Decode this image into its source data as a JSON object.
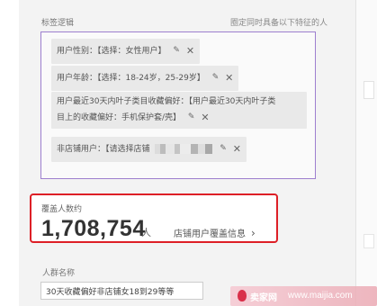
{
  "section": {
    "tag_logic_label": "标签逻辑",
    "hint": "圈定同时具备以下特征的人"
  },
  "tags": [
    {
      "text": "用户性别：【选择：女性用户】"
    },
    {
      "text": "用户年龄：【选择：18-24岁，25-29岁】"
    },
    {
      "line1": "用户最近30天内叶子类目收藏偏好：【用户最近30天内叶子类",
      "line2": "目上的收藏偏好：手机保护套/壳】"
    },
    {
      "text": "非店铺用户：【请选择店铺"
    }
  ],
  "tag_actions": {
    "edit_icon": "pencil-icon",
    "edit_glyph": "✎",
    "delete_icon": "close-icon",
    "delete_glyph": "✕"
  },
  "coverage": {
    "label": "覆盖人数约",
    "count": "1,708,754",
    "unit": "人",
    "link": "店铺用户覆盖信息",
    "link_chevron": "›",
    "highlight_color": "#dd1f26"
  },
  "crowd_name": {
    "label": "人群名称",
    "value": "30天收藏偏好非店铺女18到29等等"
  },
  "watermark": {
    "brand": "卖家网",
    "url": "www.maijia.com"
  },
  "colors": {
    "logic_border": "#9d7fcf",
    "tag_bg": "#e9e9e9"
  }
}
